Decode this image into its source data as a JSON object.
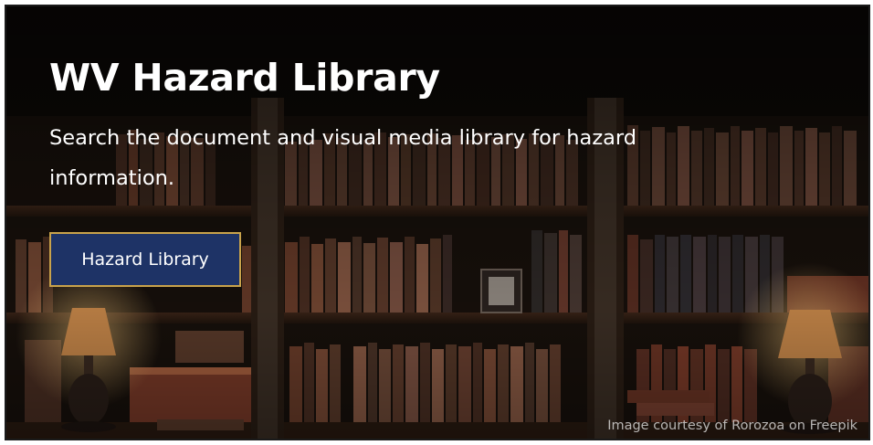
{
  "hero": {
    "title": "WV Hazard Library",
    "description": "Search the document and visual media library for hazard information.",
    "button_label": "Hazard Library",
    "image_credit": "Image courtesy of Rorozoa on Freepik"
  },
  "colors": {
    "button_bg": "#1e3366",
    "button_border": "#c9a34b",
    "text": "#ffffff"
  }
}
